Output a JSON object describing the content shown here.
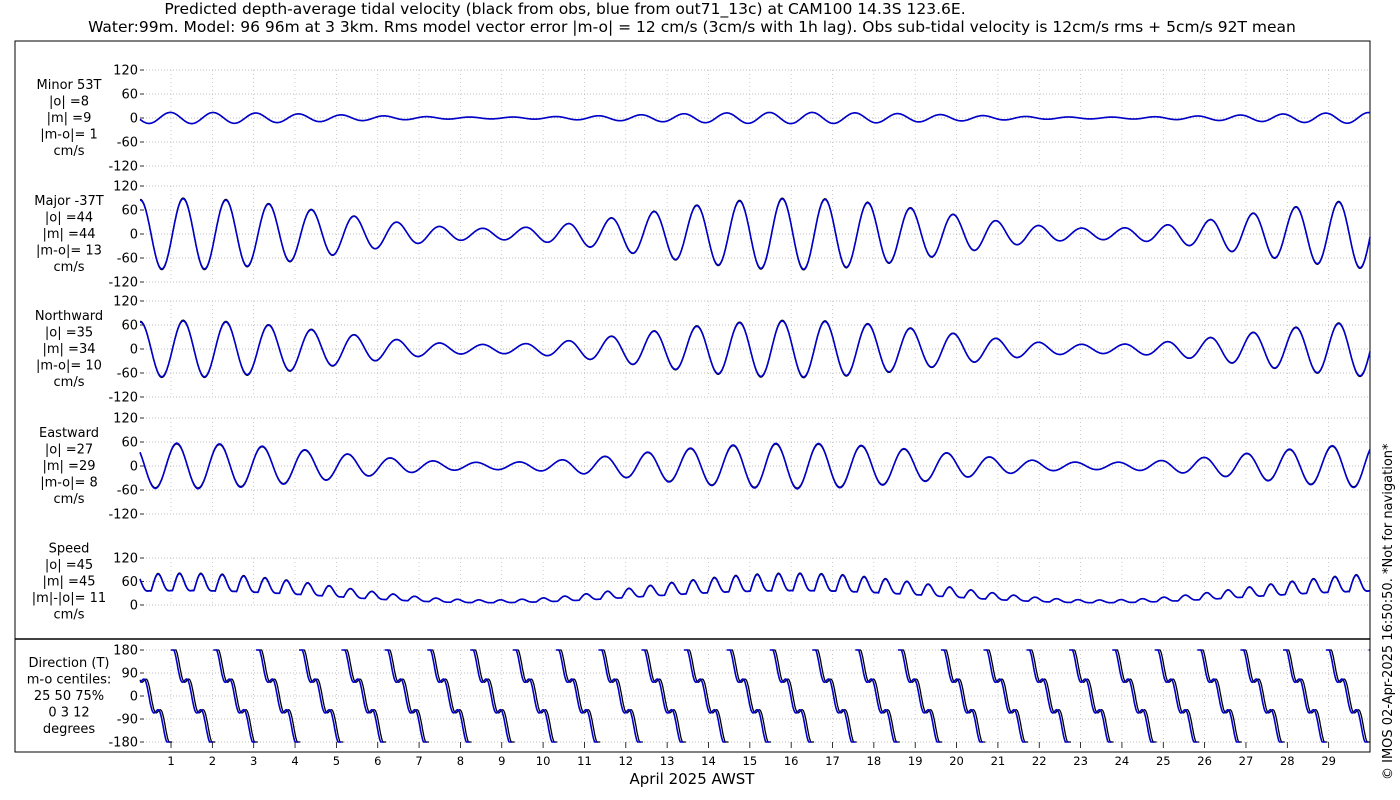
{
  "title_line1": "Predicted depth-average tidal velocity (black from obs, blue from out71_13c) at CAM100 14.3S 123.6E.",
  "title_line2": "Water:99m. Model: 96 96m at 3 3km. Rms model vector error |m-o| = 12 cm/s (3cm/s with 1h lag). Obs sub-tidal velocity is 12cm/s rms + 5cm/s 92T mean",
  "copyright": "© IMOS 02-Apr-2025 16:50:50. *Not for navigation*",
  "colors": {
    "obs": "#000000",
    "model": "#0000cc",
    "grid": "#aaaaaa",
    "frame": "#000000"
  },
  "chart_data": {
    "type": "line",
    "xlabel": "April 2025 AWST",
    "x_ticks": [
      "1",
      "2",
      "3",
      "4",
      "5",
      "6",
      "7",
      "8",
      "9",
      "10",
      "11",
      "12",
      "13",
      "14",
      "15",
      "16",
      "17",
      "18",
      "19",
      "20",
      "21",
      "22",
      "23",
      "24",
      "25",
      "26",
      "27",
      "28",
      "29"
    ],
    "xlim": [
      0.25,
      30.0
    ],
    "legend": "none",
    "grid": true,
    "panels": [
      {
        "id": "minor",
        "label_lines": [
          "Minor 53T",
          "|o| =8",
          "|m| =9",
          "|m-o|= 1",
          "cm/s"
        ],
        "ylim": [
          -120,
          120
        ],
        "y_ticks": [
          "120",
          "60",
          "0",
          "-60",
          "-120"
        ],
        "series": [
          {
            "name": "obs",
            "kind": "velocity",
            "amplitude": 14,
            "phase": 0.3
          },
          {
            "name": "model",
            "kind": "velocity",
            "amplitude": 14,
            "phase": 0.3
          }
        ]
      },
      {
        "id": "major",
        "label_lines": [
          "Major -37T",
          "|o| =44",
          "|m| =44",
          "|m-o|= 13",
          "cm/s"
        ],
        "ylim": [
          -120,
          120
        ],
        "y_ticks": [
          "120",
          "60",
          "0",
          "-60",
          "-120"
        ],
        "series": [
          {
            "name": "obs",
            "kind": "velocity",
            "amplitude": 90,
            "phase": 0
          },
          {
            "name": "model",
            "kind": "velocity",
            "amplitude": 88,
            "phase": 0
          }
        ]
      },
      {
        "id": "northward",
        "label_lines": [
          "Northward",
          "|o| =35",
          "|m| =34",
          "|m-o|= 10",
          "cm/s"
        ],
        "ylim": [
          -120,
          120
        ],
        "y_ticks": [
          "120",
          "60",
          "0",
          "-60",
          "-120"
        ],
        "series": [
          {
            "name": "obs",
            "kind": "velocity",
            "amplitude": 72,
            "phase": 0
          },
          {
            "name": "model",
            "kind": "velocity",
            "amplitude": 70,
            "phase": 0
          }
        ]
      },
      {
        "id": "eastward",
        "label_lines": [
          "Eastward",
          "|o| =27",
          "|m| =29",
          "|m-o|= 8",
          "cm/s"
        ],
        "ylim": [
          -120,
          120
        ],
        "y_ticks": [
          "120",
          "60",
          "0",
          "-60",
          "-120"
        ],
        "series": [
          {
            "name": "obs",
            "kind": "velocity",
            "amplitude": 55,
            "phase": 0.15
          },
          {
            "name": "model",
            "kind": "velocity",
            "amplitude": 57,
            "phase": 0.15
          }
        ]
      },
      {
        "id": "speed",
        "label_lines": [
          "Speed",
          "|o| =45",
          "|m| =45",
          "|m|-|o|= 11",
          "cm/s"
        ],
        "ylim": [
          0,
          120
        ],
        "y_ticks": [
          "120",
          "60",
          "0"
        ],
        "series": [
          {
            "name": "obs",
            "kind": "speed",
            "amplitude": 90,
            "phase": 0
          },
          {
            "name": "model",
            "kind": "speed",
            "amplitude": 88,
            "phase": 0
          }
        ]
      },
      {
        "id": "direction",
        "label_lines": [
          "Direction (T)",
          "m-o centiles:",
          "25  50  75%",
          "0   3  12",
          "degrees"
        ],
        "ylim": [
          -180,
          180
        ],
        "y_ticks": [
          "180",
          "90",
          "0",
          "-90",
          "-180"
        ],
        "series": [
          {
            "name": "obs",
            "kind": "direction",
            "amplitude": 180,
            "phase": 0
          },
          {
            "name": "model",
            "kind": "direction",
            "amplitude": 180,
            "phase": 0.05
          }
        ]
      }
    ]
  }
}
